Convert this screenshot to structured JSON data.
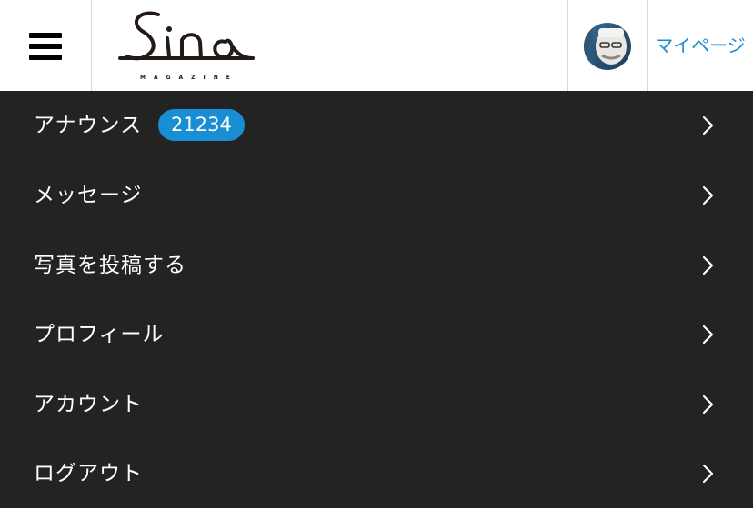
{
  "header": {
    "logo_text": "Sino",
    "logo_subtext": "MAGAZINE",
    "mypage_label": "マイページ"
  },
  "menu": {
    "items": [
      {
        "label": "アナウンス",
        "badge": "21234"
      },
      {
        "label": "メッセージ"
      },
      {
        "label": "写真を投稿する"
      },
      {
        "label": "プロフィール"
      },
      {
        "label": "アカウント"
      },
      {
        "label": "ログアウト"
      }
    ]
  },
  "colors": {
    "accent": "#1a8ed4",
    "menu_background": "#232323",
    "menu_text": "#ffffff",
    "divider": "#d9d9d9"
  },
  "icons": {
    "menu": "hamburger-icon",
    "row_arrow": "chevron-right-icon"
  }
}
